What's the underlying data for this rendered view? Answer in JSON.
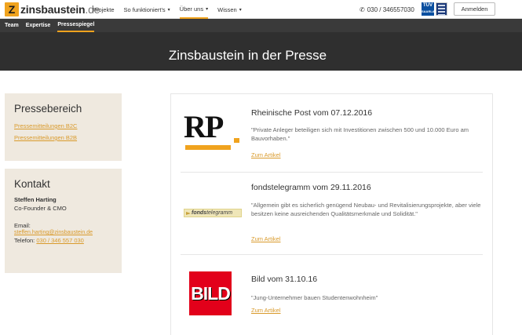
{
  "header": {
    "logo_mark": "Z",
    "logo_name": "zinsbaustein",
    "logo_tld": ".de",
    "nav": [
      {
        "label": "Projekte",
        "has_caret": false
      },
      {
        "label": "So funktioniert's",
        "has_caret": true
      },
      {
        "label": "Über uns",
        "has_caret": true,
        "active": true
      },
      {
        "label": "Wissen",
        "has_caret": true
      }
    ],
    "phone": "030 / 346557030",
    "tuv_label": "TÜV",
    "tuv_sub": "SAARLAND",
    "login_label": "Anmelden",
    "caret_glyph": "▾",
    "phone_glyph": "✆"
  },
  "subnav": {
    "items": [
      {
        "label": "Team"
      },
      {
        "label": "Expertise"
      },
      {
        "label": "Pressespiegel",
        "active": true
      }
    ]
  },
  "hero": {
    "title": "Zinsbaustein in der Presse"
  },
  "sidebar": {
    "press": {
      "title": "Pressebereich",
      "links": [
        "Pressemitteilungen B2C",
        "Pressemitteilungen B2B"
      ]
    },
    "contact": {
      "title": "Kontakt",
      "name": "Steffen Harting",
      "role": "Co-Founder & CMO",
      "email_label": "Email:",
      "email": "steffen.harting@zinsbaustein.de",
      "phone_label": "Telefon:",
      "phone": "030 / 346 557 030"
    }
  },
  "articles": [
    {
      "logo_text": "RP",
      "title": "Rheinische Post vom 07.12.2016",
      "quote": "\"Private Anleger beteiligen sich mit Investitionen zwischen 500 und 10.000 Euro am Bauvorhaben.\"",
      "link": "Zum Artikel"
    },
    {
      "logo_text_a": "fonds",
      "logo_text_b": "telegramm",
      "title": "fondstelegramm vom 29.11.2016",
      "quote": "\"Allgemein gibt es sicherlich genügend Neubau- und Revitalisierungsprojekte, aber viele besitzen keine ausreichenden Qualitätsmerkmale und Solidität.\"",
      "link": "Zum Artikel"
    },
    {
      "logo_text": "BILD",
      "title": "Bild vom 31.10.16",
      "quote": "\"Jung-Unternehmer bauen Studentenwohnheim\"",
      "link": "Zum Artikel"
    }
  ],
  "colors": {
    "accent": "#f0a31e",
    "hero_bg": "#2f2f2f",
    "sidebar_bg": "#efe9df",
    "bild_red": "#e2001a"
  }
}
